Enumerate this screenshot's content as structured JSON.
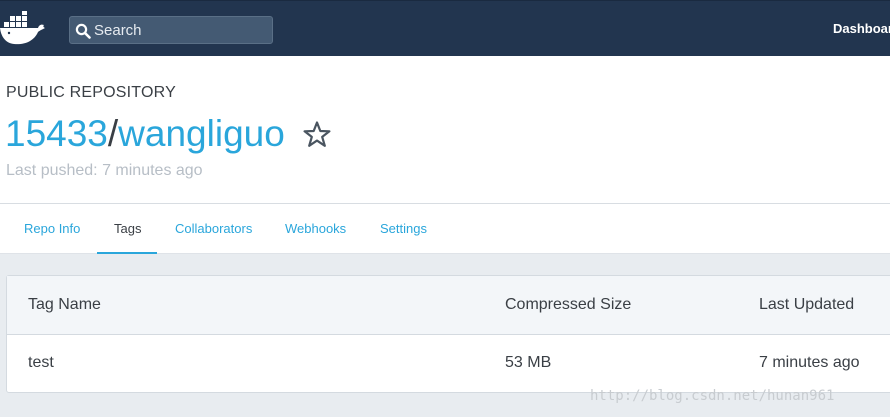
{
  "topbar": {
    "logo_icon": "docker-whale-icon",
    "search": {
      "placeholder": "Search",
      "value": ""
    },
    "nav_dashboard": "Dashboard",
    "colors": {
      "background": "#22354f",
      "search_bg": "#445a73"
    }
  },
  "repo": {
    "kind": "PUBLIC REPOSITORY",
    "namespace": "15433",
    "separator": "/",
    "name": "wangliguo",
    "star_icon": "star-outline-icon",
    "last_pushed": "Last pushed: 7 minutes ago"
  },
  "tabs": [
    {
      "label": "Repo Info",
      "active": false
    },
    {
      "label": "Tags",
      "active": true
    },
    {
      "label": "Collaborators",
      "active": false
    },
    {
      "label": "Webhooks",
      "active": false
    },
    {
      "label": "Settings",
      "active": false
    }
  ],
  "tags_table": {
    "headers": [
      "Tag Name",
      "Compressed Size",
      "Last Updated"
    ],
    "rows": [
      [
        "test",
        "53 MB",
        "7 minutes ago"
      ]
    ]
  },
  "watermark": "http://blog.csdn.net/hunan961",
  "colors": {
    "accent": "#2aa6db",
    "text": "#3a3f45",
    "muted": "#b7bec6"
  }
}
